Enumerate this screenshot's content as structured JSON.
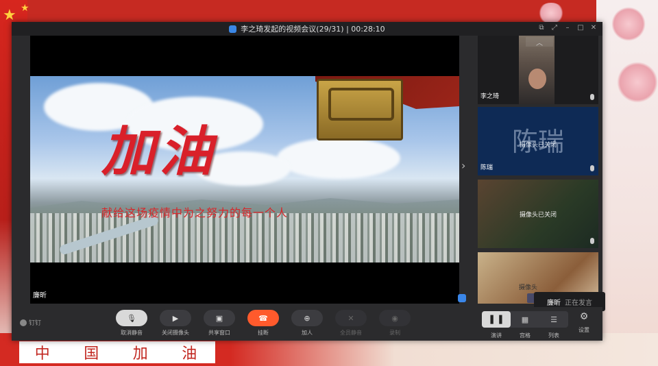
{
  "window": {
    "title": "李之琦发起的视频会议(29/31) | 00:28:10",
    "controls": [
      "restore-icon",
      "fullscreen-icon",
      "minimize-icon",
      "maximize-icon",
      "close-icon"
    ]
  },
  "main_video": {
    "headline": "加油",
    "subline": "献给这场疫情中为之努力的每一个人",
    "participant_name": "廉昕"
  },
  "participants": [
    {
      "name": "李之琦",
      "camera_status": ""
    },
    {
      "name": "陈瑞",
      "avatar_text": "陈瑞",
      "camera_status": "摄像头已关闭"
    },
    {
      "name": "",
      "camera_status": "摄像头已关闭"
    },
    {
      "name": "",
      "camera_status": "摄像头"
    }
  ],
  "speaking_indicator": {
    "name": "廉昕",
    "status": "正在发言"
  },
  "toolbar": {
    "logo": "钉钉",
    "buttons": [
      {
        "label": "取消静音",
        "icon": "mic-muted-icon",
        "glyph": "🎙"
      },
      {
        "label": "关闭摄像头",
        "icon": "camera-icon",
        "glyph": "▶"
      },
      {
        "label": "共享窗口",
        "icon": "share-window-icon",
        "glyph": "▣"
      },
      {
        "label": "挂断",
        "icon": "hangup-icon",
        "glyph": "☎"
      },
      {
        "label": "加人",
        "icon": "add-person-icon",
        "glyph": "⊕"
      },
      {
        "label": "全员静音",
        "icon": "mute-all-icon",
        "glyph": "✕"
      },
      {
        "label": "录制",
        "icon": "record-icon",
        "glyph": "◉"
      }
    ],
    "views": [
      {
        "label": "演讲",
        "icon": "speaker-view-icon",
        "glyph": "▌▐"
      },
      {
        "label": "宫格",
        "icon": "grid-view-icon",
        "glyph": "▦"
      },
      {
        "label": "列表",
        "icon": "list-view-icon",
        "glyph": "☰"
      }
    ],
    "settings_label": "设置",
    "settings_glyph": "⚙"
  },
  "background": {
    "banner": [
      "中",
      "国",
      "加",
      "油"
    ]
  },
  "colors": {
    "hangup": "#ff5a2c",
    "accent": "#3a86e8",
    "headline": "#d9202a"
  }
}
